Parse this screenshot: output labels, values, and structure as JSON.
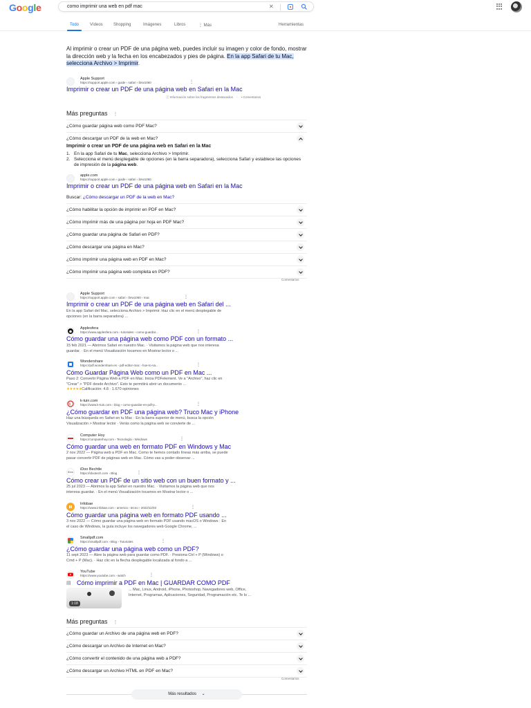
{
  "header": {
    "logo": "Google",
    "query": "como imprimir una web en pdf mac"
  },
  "tabs": [
    {
      "label": "Todo"
    },
    {
      "label": "Vídeos"
    },
    {
      "label": "Shopping"
    },
    {
      "label": "Imágenes"
    },
    {
      "label": "Libros"
    },
    {
      "label": "⋮ Más"
    },
    {
      "label": "Herramientas"
    }
  ],
  "snippet": {
    "text": "Al imprimir o crear un PDF de una página web, puedes incluir su imagen y color de fondo, mostrar la dirección web y la fecha en los encabezados y pies de página. ",
    "highlight": "En la app Safari de tu Mac, selecciona Archivo > Imprimir",
    "tail": ".",
    "source_name": "Apple Support",
    "source_url": "https://support.apple.com › guide › safari › ibrw1060",
    "title": "Imprimir o crear un PDF de una página web en Safari en la Mac",
    "about": "Información sobre los fragmentos destacados",
    "comments": "Comentarios"
  },
  "paa1": {
    "title": "Más preguntas",
    "q0": "¿Cómo guardar página web como PDF Mac?",
    "q1": "¿Cómo descargar un PDF de la web en Mac?",
    "exp_heading": "Imprimir o crear un PDF de una página web en Safari en la Mac",
    "exp_step1_a": "En la app Safari de tu ",
    "exp_step1_b": "Mac",
    "exp_step1_c": ", selecciona Archivo > Imprimir.",
    "exp_step2_a": "Selecciona el menú desplegable de opciones (en la barra separadora), selecciona Safari y establece las opciones de impresión de la ",
    "exp_step2_b": "página web",
    "exp_step2_c": ".",
    "exp_source_name": "apple.com",
    "exp_source_url": "https://support.apple.com › guide › safari › ibrw1060",
    "exp_title": "Imprimir o crear un PDF de una página web en Safari en la Mac",
    "buscar_label": "Buscar: ",
    "buscar_link": "¿Cómo descargar un PDF de la web en Mac?",
    "q2": "¿Cómo habilitar la opción de imprimir en PDF en Mac?",
    "q3": "¿Cómo imprimir más de una página por hoja en PDF Mac?",
    "q4": "¿Cómo guardar una página de Safari en PDF?",
    "q5": "¿Cómo descargar una página en Mac?",
    "q6": "¿Cómo imprimir una página web en PDF en Mac?",
    "q7": "¿Cómo imprimir una página web completa en PDF?",
    "comments": "Comentarios"
  },
  "results": [
    {
      "name": "Apple Support",
      "url": "https://support.apple.com › safari › ibrw1060 › mac",
      "title": "Imprimir o crear un PDF de una página web en Safari del ...",
      "desc1": "En la app Safari del Mac, selecciona Archivo > Imprimir. Haz clic en el menú desplegable de",
      "desc2": "opciones (en la barra separadora) ..."
    },
    {
      "name": "Applesfera",
      "url": "https://www.applesfera.com › tutoriales › como-guardar...",
      "title": "Cómo guardar una página web como PDF con un formato ...",
      "desc1": "15 feb 2021 — Abrimos Safari en nuestro Mac. · Visitamos la página web que nos interesa",
      "desc2": "guardar. · En el menú Visualización tocamos en Mostrar lector o ..."
    },
    {
      "name": "Wondershare",
      "url": "https://pdf.wondershare.es › pdf-editor-mac › hoe-to-sa...",
      "title": "Cómo Guardar Página Web como un PDF en Mac ...",
      "desc1": "Paso 2: Convertir Página Web a PDF en Mac. Inicia PDFelement. Ve a \"Archivo\", haz clic en",
      "desc2": "\"Crear\" > \"PDF desde Archivo\". Esto te permitirá abrir un documento ...",
      "rating": "★★★★★",
      "rating_text": "Calificación: 4.8 · 1.670 opiniones"
    },
    {
      "name": "k-tuin.com",
      "url": "https://www.k-tuin.com › blog › como-guardar-en-pdf-p...",
      "title": "¿Cómo guardar en PDF una página web? Truco Mac y iPhone",
      "desc1": "Haz una búsqueda en Safari en tu Mac · En la barra superior de menú, busca la opción",
      "desc2": "Visualización > Mostrar lector · Verás como la página web se convierte de ..."
    },
    {
      "name": "Computer Hoy",
      "url": "https://computerhoy.com › Tecnología › Windows",
      "title": "Cómo guardar una web en formato PDF en Windows y Mac",
      "desc1": "2 nov 2022 — Página web a PDF en Mac. Como te hemos contado líneas más arriba, se puede",
      "desc2": "pasar convertir PDF de páginas web en Mac. Cómo vas a poder observar ..."
    },
    {
      "name": "iDoo Bechtle",
      "url": "https://idootech.com › Blog",
      "title": "Cómo crear un PDF de un sitio web con un buen formato y ...",
      "desc1": "25 jul 2023 — Abrimos la app Safari en nuestro Mac. · Visitamos la página web que nos",
      "desc2": "interesa guardar. · En el menú Visualización tocamos en Mostrar lector o ..."
    },
    {
      "name": "Infobae",
      "url": "https://www.infobae.com › america › tecno › 2022/11/03",
      "title": "Cómo guardar una página web en formato PDF usando ...",
      "desc1": "3 nov 2022 — Cómo guardar una página web en formato PDF usando macOS o Windows · En",
      "desc2": "el caso de Windows, la guía incluye los navegadores web Google Chrome, ..."
    },
    {
      "name": "Smallpdf.com",
      "url": "https://smallpdf.com › Blog › Tutoriales",
      "title": "¿Cómo guardar una página web como un PDF?",
      "desc1": "11 sept 2023 — Abre la página web para guardar como PDF. · Presiona Ctrl + P (Windows) o",
      "desc2": "Cmd + P (Mac). · Haz clic en la flecha desplegable localizada al fondo a ..."
    },
    {
      "name": "YouTube",
      "url": "https://www.youtube.com › watch",
      "title": "Cómo imprimir a PDF en Mac | GUARDAR COMO PDF",
      "vdesc1": "... Mac, Linux, Android, iPhone, Photoshop, Navegadores web, Office,",
      "vdesc2": "Internet, Programas, Aplicaciones, Seguridad, Programación etc. Te lo ...",
      "duration": "1:18"
    }
  ],
  "paa2": {
    "title": "Más preguntas",
    "q0": "¿Cómo guardar un Archivo de una página web en PDF?",
    "q1": "¿Cómo descargar un Archivo de Internet en Mac?",
    "q2": "¿Cómo convertir el contenido de una página web a PDF?",
    "q3": "¿Cómo descargar un Archivo HTML en PDF en Mac?",
    "comments": "Comentarios"
  },
  "more_results": "Más resultados",
  "colors": {
    "link": "#1a0dab",
    "accent": "#1a73e8",
    "highlight": "#d3e3fd"
  }
}
